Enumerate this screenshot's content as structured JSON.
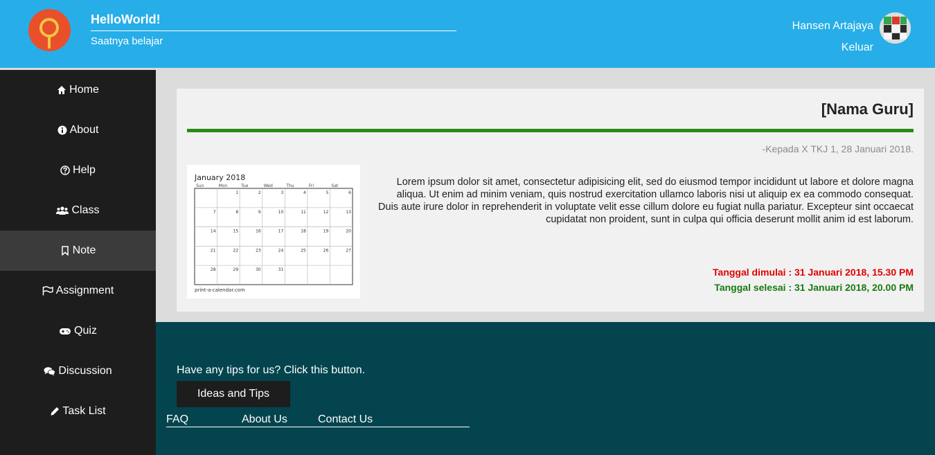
{
  "header": {
    "brand_title": "HelloWorld!",
    "brand_subtitle": "Saatnya belajar",
    "user_name": "Hansen Artajaya",
    "logout_label": "Keluar"
  },
  "sidebar": {
    "items": [
      {
        "label": "Home",
        "icon": "home-icon"
      },
      {
        "label": "About",
        "icon": "info-icon"
      },
      {
        "label": "Help",
        "icon": "help-icon"
      },
      {
        "label": "Class",
        "icon": "users-icon"
      },
      {
        "label": "Note",
        "icon": "bookmark-icon",
        "active": true
      },
      {
        "label": "Assignment",
        "icon": "flag-icon"
      },
      {
        "label": "Quiz",
        "icon": "gamepad-icon"
      },
      {
        "label": "Discussion",
        "icon": "comments-icon"
      },
      {
        "label": "Task List",
        "icon": "pencil-icon"
      }
    ]
  },
  "note": {
    "title": "[Nama Guru]",
    "meta": "-Kepada X TKJ 1, 28 Januari 2018.",
    "body": "Lorem ipsum dolor sit amet, consectetur adipisicing elit, sed do eiusmod tempor incididunt ut labore et dolore magna aliqua. Ut enim ad minim veniam, quis nostrud exercitation ullamco laboris nisi ut aliquip ex ea commodo consequat. Duis aute irure dolor in reprehenderit in voluptate velit esse cillum dolore eu fugiat nulla pariatur. Excepteur sint occaecat cupidatat non proident, sunt in culpa qui officia deserunt mollit anim id est laborum.",
    "start": "Tanggal dimulai : 31 Januari 2018, 15.30 PM",
    "end": "Tanggal selesai : 31 Januari 2018, 20.00 PM",
    "calendar": {
      "month": "January 2018",
      "weekdays": [
        "Sun",
        "Mon",
        "Tue",
        "Wed",
        "Thu",
        "Fri",
        "Sat"
      ],
      "days": [
        "",
        "1",
        "2",
        "3",
        "4",
        "5",
        "6",
        "7",
        "8",
        "9",
        "10",
        "11",
        "12",
        "13",
        "14",
        "15",
        "16",
        "17",
        "18",
        "19",
        "20",
        "21",
        "22",
        "23",
        "24",
        "25",
        "26",
        "27",
        "28",
        "29",
        "30",
        "31",
        "",
        "",
        ""
      ],
      "footer": "print-a-calendar.com"
    }
  },
  "footer": {
    "tips_text": "Have any tips for us? Click this button.",
    "tips_button": "Ideas and Tips",
    "links": [
      "FAQ",
      "About Us",
      "Contact Us"
    ]
  },
  "colors": {
    "header_bg": "#27aee8",
    "sidebar_bg": "#1d1d1d",
    "accent_green": "#2b8a17",
    "footer_bg": "#03444e",
    "start_red": "#e00000",
    "end_green": "#1a7a10"
  }
}
